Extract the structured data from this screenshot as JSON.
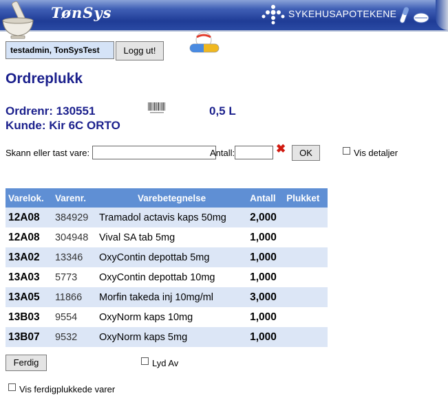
{
  "header": {
    "logo_text": "TønSys",
    "org_name": "SYKEHUSAPOTEKENE",
    "icons": [
      "mortar-pestle-icon",
      "sykehusapotekene-dots-icon",
      "pills-icon"
    ]
  },
  "user": {
    "name": "testadmin, TonSysTest",
    "logout_label": "Logg ut!"
  },
  "page": {
    "title": "Ordreplukk",
    "order_no_label": "Ordrenr: 130551",
    "customer_label": "Kunde: Kir 6C ORTO",
    "volume": "0,5 L"
  },
  "scan": {
    "label": "Skann eller tast vare:",
    "value": "",
    "qty_label": "Antall:",
    "qty_value": "",
    "ok_label": "OK",
    "details_label": "Vis detaljer",
    "details_checked": false
  },
  "table": {
    "headers": [
      "Varelok.",
      "Varenr.",
      "Varebetegnelse",
      "Antall",
      "Plukket"
    ],
    "rows": [
      {
        "loc": "12A08",
        "nr": "384929",
        "name": "Tramadol actavis kaps 50mg",
        "qty": "2,000",
        "picked": ""
      },
      {
        "loc": "12A08",
        "nr": "304948",
        "name": "Vival SA tab 5mg",
        "qty": "1,000",
        "picked": ""
      },
      {
        "loc": "13A02",
        "nr": "13346",
        "name": "OxyContin depottab 5mg",
        "qty": "1,000",
        "picked": ""
      },
      {
        "loc": "13A03",
        "nr": "5773",
        "name": "OxyContin depottab 10mg",
        "qty": "1,000",
        "picked": ""
      },
      {
        "loc": "13A05",
        "nr": "11866",
        "name": "Morfin takeda inj 10mg/ml",
        "qty": "3,000",
        "picked": ""
      },
      {
        "loc": "13B03",
        "nr": "9554",
        "name": "OxyNorm kaps 10mg",
        "qty": "1,000",
        "picked": ""
      },
      {
        "loc": "13B07",
        "nr": "9532",
        "name": "OxyNorm kaps 5mg",
        "qty": "1,000",
        "picked": ""
      }
    ]
  },
  "footer": {
    "done_label": "Ferdig",
    "sound_off_label": "Lyd Av",
    "sound_off_checked": false,
    "show_done_label": "Vis ferdigplukkede varer",
    "show_done_checked": false
  },
  "colors": {
    "title": "#1a1f8c",
    "table_header": "#5f8fd4",
    "row_alt": "#dce6f6",
    "banner": "#1f3c96"
  }
}
